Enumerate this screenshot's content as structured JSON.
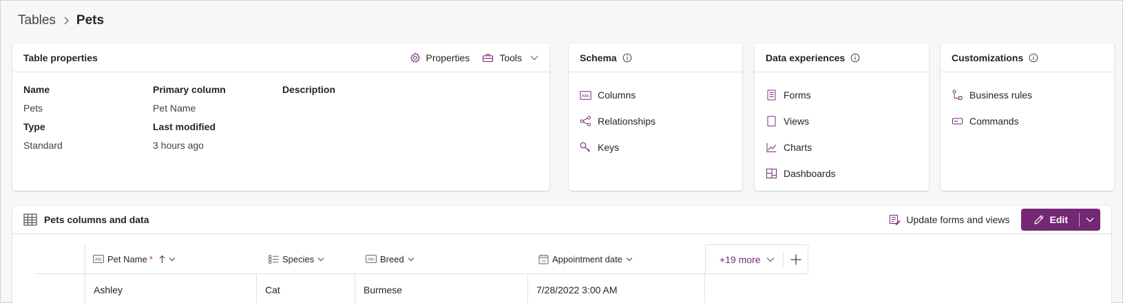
{
  "breadcrumb": {
    "parent": "Tables",
    "current": "Pets"
  },
  "table_properties": {
    "title": "Table properties",
    "properties_label": "Properties",
    "tools_label": "Tools",
    "name_label": "Name",
    "name_value": "Pets",
    "type_label": "Type",
    "type_value": "Standard",
    "primary_column_label": "Primary column",
    "primary_column_value": "Pet Name",
    "last_modified_label": "Last modified",
    "last_modified_value": "3 hours ago",
    "description_label": "Description"
  },
  "schema": {
    "title": "Schema",
    "items": [
      {
        "label": "Columns",
        "icon": "text-field-icon"
      },
      {
        "label": "Relationships",
        "icon": "relationships-icon"
      },
      {
        "label": "Keys",
        "icon": "key-icon"
      }
    ]
  },
  "data_experiences": {
    "title": "Data experiences",
    "items": [
      {
        "label": "Forms",
        "icon": "form-icon"
      },
      {
        "label": "Views",
        "icon": "view-icon"
      },
      {
        "label": "Charts",
        "icon": "chart-icon"
      },
      {
        "label": "Dashboards",
        "icon": "dashboard-icon"
      }
    ]
  },
  "customizations": {
    "title": "Customizations",
    "items": [
      {
        "label": "Business rules",
        "icon": "business-rules-icon"
      },
      {
        "label": "Commands",
        "icon": "commands-icon"
      }
    ]
  },
  "data_grid": {
    "title": "Pets columns and data",
    "update_label": "Update forms and views",
    "edit_label": "Edit",
    "more_label": "+19 more",
    "columns": [
      {
        "label": "Pet Name",
        "required_mark": "*"
      },
      {
        "label": "Species"
      },
      {
        "label": "Breed"
      },
      {
        "label": "Appointment date"
      }
    ],
    "rows": [
      {
        "pet_name": "Ashley",
        "species": "Cat",
        "breed": "Burmese",
        "appointment_date": "7/28/2022 3:00 AM"
      }
    ]
  },
  "colors": {
    "accent": "#742774",
    "text": "#242424",
    "background": "#f8f7f6",
    "border": "#e0e0e0"
  }
}
